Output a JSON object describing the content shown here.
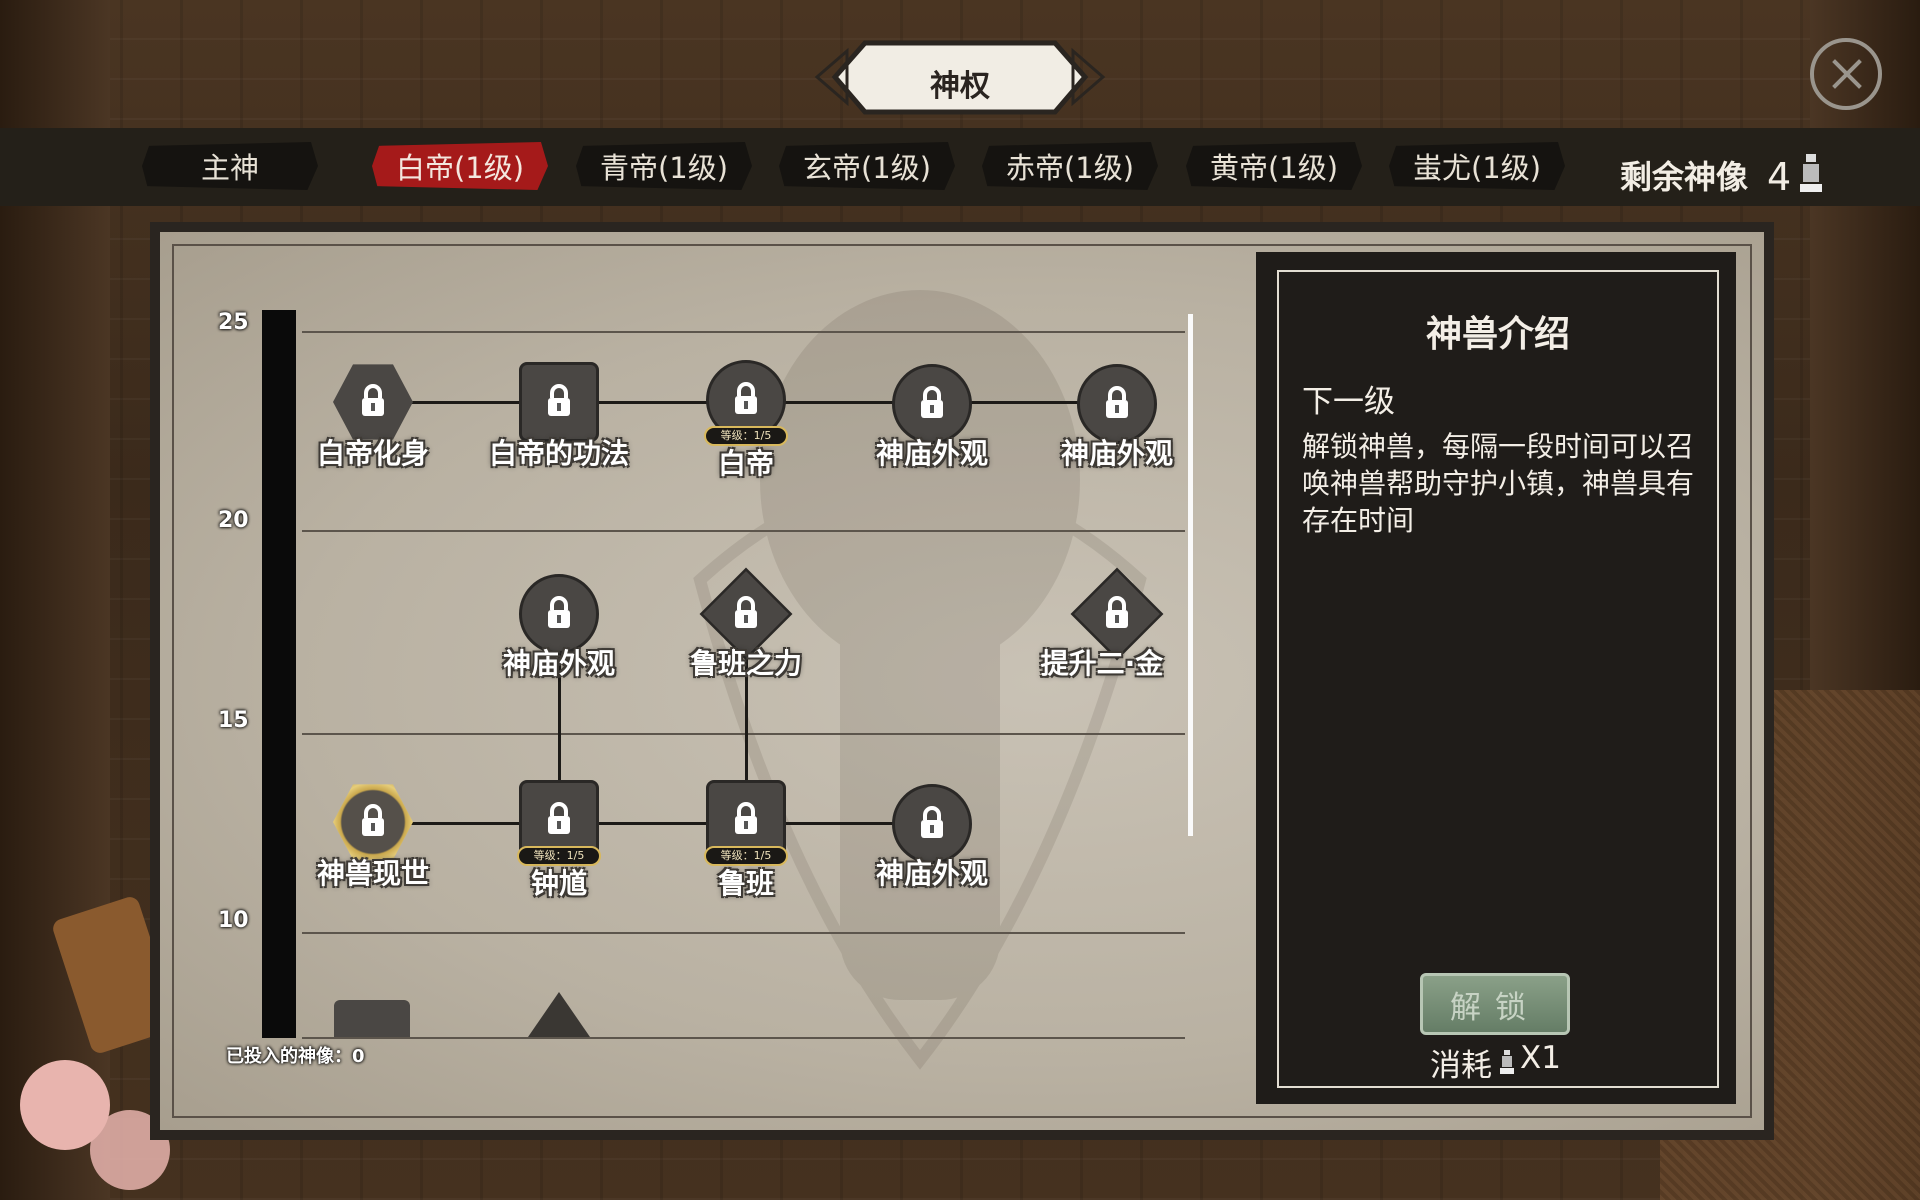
{
  "header": {
    "title": "神权"
  },
  "tabs": [
    {
      "label": "主神",
      "active": false
    },
    {
      "label": "白帝(1级)",
      "active": true
    },
    {
      "label": "青帝(1级)",
      "active": false
    },
    {
      "label": "玄帝(1级)",
      "active": false
    },
    {
      "label": "赤帝(1级)",
      "active": false
    },
    {
      "label": "黄帝(1级)",
      "active": false
    },
    {
      "label": "蚩尤(1级)",
      "active": false
    }
  ],
  "remaining": {
    "label": "剩余神像",
    "value": "4",
    "icon": "statue-icon"
  },
  "tree": {
    "levels": [
      "25",
      "20",
      "15",
      "10"
    ],
    "nodes": [
      {
        "label": "白帝化身",
        "shape": "hex",
        "locked": true
      },
      {
        "label": "白帝的功法",
        "shape": "square",
        "locked": true
      },
      {
        "label": "白帝",
        "shape": "circle",
        "locked": true,
        "badge": "等级：1/5"
      },
      {
        "label": "神庙外观",
        "shape": "circle",
        "locked": true
      },
      {
        "label": "神庙外观",
        "shape": "circle",
        "locked": true
      },
      {
        "label": "神庙外观",
        "shape": "circle",
        "locked": true
      },
      {
        "label": "鲁班之力",
        "shape": "diamond",
        "locked": true
      },
      {
        "label": "提升二·金",
        "shape": "diamond",
        "locked": true
      },
      {
        "label": "神兽现世",
        "shape": "hex-gold",
        "locked": true
      },
      {
        "label": "钟馗",
        "shape": "square",
        "locked": true,
        "badge": "等级：1/5"
      },
      {
        "label": "鲁班",
        "shape": "square",
        "locked": true,
        "badge": "等级：1/5"
      },
      {
        "label": "神庙外观",
        "shape": "circle",
        "locked": true
      }
    ],
    "invested_label": "已投入的神像：0"
  },
  "panel": {
    "title": "神兽介绍",
    "subtitle": "下一级",
    "description": "解锁神兽，每隔一段时间可以召唤神兽帮助守护小镇，神兽具有存在时间",
    "button": "解锁",
    "cost_label": "消耗",
    "cost_value": "X1"
  },
  "colors": {
    "active_tab": "#a51a1a",
    "tab_bg": "#151310",
    "panel_bg": "#1f1c19",
    "paper": "#c9c2b5",
    "badge_border": "#d8b85c"
  }
}
